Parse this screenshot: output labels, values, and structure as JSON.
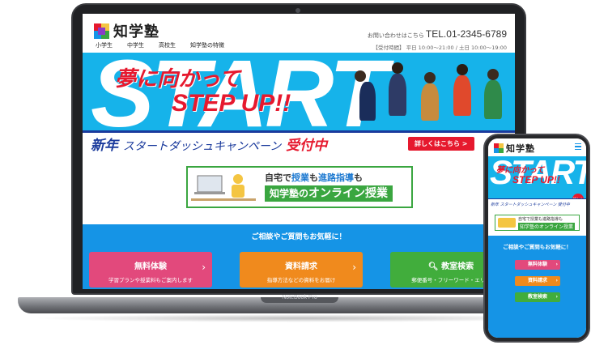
{
  "laptop": {
    "brand": "NoteBook Pro",
    "site": {
      "logo_text": "知学塾",
      "nav": [
        "小学生",
        "中学生",
        "高校生",
        "知学塾の特徴"
      ],
      "contact_prefix": "お問い合わせはこちら",
      "tel": "TEL.01-2345-6789",
      "hours": "【受付時間】 平日 10:00～21:00 / 土日 10:00～19:00",
      "hero": {
        "bg_word": "START",
        "title_line1": "夢に向かって",
        "title_line2": "STEP UP!!",
        "banner_part1": "新年",
        "banner_part2": "スタートダッシュキャンペーン",
        "banner_part3": "受付中",
        "banner_button": "詳しくはこちら >"
      },
      "online": {
        "line1_a": "自宅で",
        "line1_b": "授業",
        "line1_c": "も",
        "line1_d": "進路指導",
        "line1_e": "も",
        "line2_a": "知学塾の",
        "line2_b": "オンライン授業"
      },
      "inquiry": {
        "title": "ご相談やご質問もお気軽に！",
        "buttons": [
          {
            "title": "無料体験",
            "sub": "学習プランや授業料もご案内します",
            "color": "#e2497c"
          },
          {
            "title": "資料請求",
            "sub": "指導方法などの資料をお届け",
            "color": "#f08a1d"
          },
          {
            "title": "教室検索",
            "sub": "郵便番号・フリーワード・エリア",
            "color": "#41ad3c"
          }
        ]
      }
    }
  },
  "phone": {
    "logo_text": "知学塾",
    "hero_title_line1": "夢に向かって",
    "hero_title_line2": "STEP UP!!",
    "bg_word": "START",
    "banner": "新年 スタートダッシュキャンペーン 受付中",
    "badge": "詳しくは",
    "online_line1": "自宅で授業も進路指導も",
    "online_line2": "知学塾のオンライン授業",
    "inquiry_title": "ご相談やご質問もお気軽に！",
    "buttons": [
      "無料体験",
      "資料請求",
      "教室検索"
    ]
  },
  "colors": {
    "hero_blue": "#16b3ea",
    "inquiry_blue": "#1594e6",
    "accent_red": "#e6192e",
    "navy": "#1a3a9c",
    "green": "#3aa640"
  }
}
